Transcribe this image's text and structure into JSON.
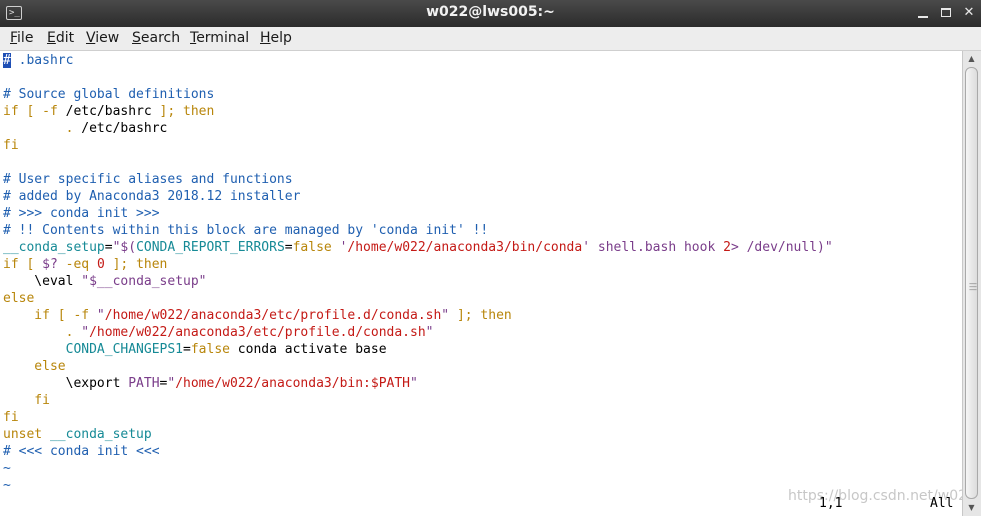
{
  "window": {
    "title": "w022@lws005:~",
    "icon": "terminal-icon",
    "buttons": [
      "minimize-icon",
      "maximize-icon",
      "close-icon"
    ]
  },
  "menu": [
    {
      "key": "F",
      "rest": "ile"
    },
    {
      "key": "E",
      "rest": "dit"
    },
    {
      "key": "V",
      "rest": "iew"
    },
    {
      "key": "S",
      "rest": "earch"
    },
    {
      "key": "T",
      "rest": "erminal"
    },
    {
      "key": "H",
      "rest": "elp"
    }
  ],
  "lines": [
    [
      {
        "t": "#",
        "c": "cursor"
      },
      {
        "t": " .bashrc",
        "c": "c-com"
      }
    ],
    [],
    [
      {
        "t": "# Source global definitions",
        "c": "c-com"
      }
    ],
    [
      {
        "t": "if [ -f ",
        "c": "c-kw"
      },
      {
        "t": "/etc/bashrc",
        "c": ""
      },
      {
        "t": " ]; then",
        "c": "c-kw"
      }
    ],
    [
      {
        "t": "        . ",
        "c": "c-kw"
      },
      {
        "t": "/etc/bashrc",
        "c": ""
      }
    ],
    [
      {
        "t": "fi",
        "c": "c-kw"
      }
    ],
    [],
    [
      {
        "t": "# User specific aliases and functions",
        "c": "c-com"
      }
    ],
    [
      {
        "t": "# added by Anaconda3 2018.12 installer",
        "c": "c-com"
      }
    ],
    [
      {
        "t": "# >>> conda init >>>",
        "c": "c-com"
      }
    ],
    [
      {
        "t": "# !! Contents within this block are managed by 'conda init' !!",
        "c": "c-com"
      }
    ],
    [
      {
        "t": "__conda_setup",
        "c": "c-cyan"
      },
      {
        "t": "=",
        "c": ""
      },
      {
        "t": "\"$(",
        "c": "c-var"
      },
      {
        "t": "CONDA_REPORT_ERRORS",
        "c": "c-cyan"
      },
      {
        "t": "=",
        "c": ""
      },
      {
        "t": "false",
        "c": "c-kw"
      },
      {
        "t": " '",
        "c": "c-var"
      },
      {
        "t": "/home/w022/anaconda3/bin/conda",
        "c": "c-str"
      },
      {
        "t": "'",
        "c": "c-var"
      },
      {
        "t": " shell.bash hook ",
        "c": "c-var"
      },
      {
        "t": "2",
        "c": "c-str"
      },
      {
        "t": "> /dev/null)\"",
        "c": "c-var"
      }
    ],
    [
      {
        "t": "if [ ",
        "c": "c-kw"
      },
      {
        "t": "$?",
        "c": "c-var"
      },
      {
        "t": " -eq ",
        "c": "c-kw"
      },
      {
        "t": "0",
        "c": "c-str"
      },
      {
        "t": " ]; then",
        "c": "c-kw"
      }
    ],
    [
      {
        "t": "    \\eval ",
        "c": ""
      },
      {
        "t": "\"$__conda_setup\"",
        "c": "c-var"
      }
    ],
    [
      {
        "t": "else",
        "c": "c-kw"
      }
    ],
    [
      {
        "t": "    if [ -f ",
        "c": "c-kw"
      },
      {
        "t": "\"",
        "c": "c-var"
      },
      {
        "t": "/home/w022/anaconda3/etc/profile.d/conda.sh",
        "c": "c-str"
      },
      {
        "t": "\"",
        "c": "c-var"
      },
      {
        "t": " ]; then",
        "c": "c-kw"
      }
    ],
    [
      {
        "t": "        . ",
        "c": "c-kw"
      },
      {
        "t": "\"",
        "c": "c-var"
      },
      {
        "t": "/home/w022/anaconda3/etc/profile.d/conda.sh",
        "c": "c-str"
      },
      {
        "t": "\"",
        "c": "c-var"
      }
    ],
    [
      {
        "t": "        CONDA_CHANGEPS1",
        "c": "c-cyan"
      },
      {
        "t": "=",
        "c": ""
      },
      {
        "t": "false",
        "c": "c-kw"
      },
      {
        "t": " conda activate base",
        "c": ""
      }
    ],
    [
      {
        "t": "    else",
        "c": "c-kw"
      }
    ],
    [
      {
        "t": "        \\export ",
        "c": ""
      },
      {
        "t": "PATH",
        "c": "c-var"
      },
      {
        "t": "=",
        "c": ""
      },
      {
        "t": "\"",
        "c": "c-var"
      },
      {
        "t": "/home/w022/anaconda3/bin:",
        "c": "c-str"
      },
      {
        "t": "$PATH",
        "c": "c-str"
      },
      {
        "t": "\"",
        "c": "c-var"
      }
    ],
    [
      {
        "t": "    fi",
        "c": "c-kw"
      }
    ],
    [
      {
        "t": "fi",
        "c": "c-kw"
      }
    ],
    [
      {
        "t": "unset ",
        "c": "c-kw"
      },
      {
        "t": "__conda_setup",
        "c": "c-cyan"
      }
    ],
    [
      {
        "t": "# <<< conda init <<<",
        "c": "c-com"
      }
    ],
    [
      {
        "t": "~",
        "c": "c-tilde"
      }
    ],
    [
      {
        "t": "~",
        "c": "c-tilde"
      }
    ]
  ],
  "status": {
    "position": "1,1",
    "scroll": "All"
  },
  "watermark": "https://blog.csdn.net/w022"
}
